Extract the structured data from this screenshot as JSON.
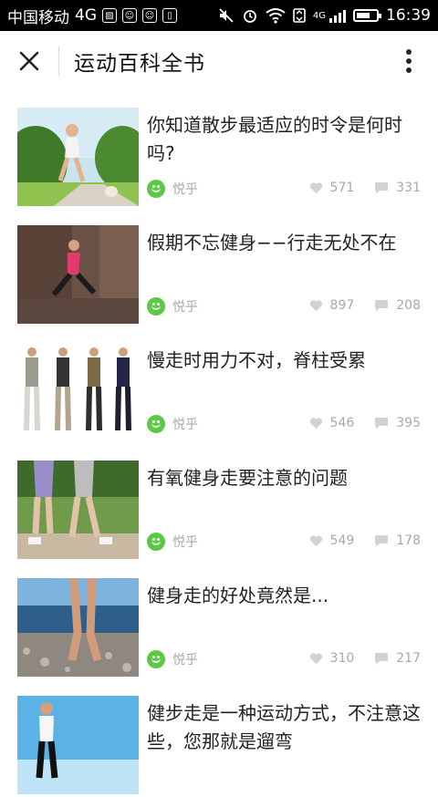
{
  "status_bar": {
    "carrier": "中国移动",
    "network": "4G",
    "signal_net": "4G",
    "time": "16:39",
    "icons": [
      "image-icon",
      "notification-icon",
      "notification-icon",
      "sim-icon",
      "mute-icon",
      "alarm-icon",
      "wifi-icon",
      "data-icon",
      "signal-icon",
      "battery-icon"
    ]
  },
  "header": {
    "title": "运动百科全书",
    "close_icon": "close-icon",
    "more_icon": "more-vertical-icon"
  },
  "colors": {
    "source_icon": "#5cc945",
    "meta_text": "#a8a8a8"
  },
  "articles": [
    {
      "title": "你知道散步最适应的时令是何时吗?",
      "source": "悦乎",
      "likes": "571",
      "comments": "331",
      "thumb": "woman-running-with-dog"
    },
    {
      "title": "假期不忘健身−−行走无处不在",
      "source": "悦乎",
      "likes": "897",
      "comments": "208",
      "thumb": "woman-running-on-path"
    },
    {
      "title": "慢走时用力不对，脊柱受累",
      "source": "悦乎",
      "likes": "546",
      "comments": "395",
      "thumb": "four-men-walking"
    },
    {
      "title": "有氧健身走要注意的问题",
      "source": "悦乎",
      "likes": "549",
      "comments": "178",
      "thumb": "legs-walking"
    },
    {
      "title": "健身走的好处竟然是...",
      "source": "悦乎",
      "likes": "310",
      "comments": "217",
      "thumb": "feet-on-pebbles"
    },
    {
      "title": "健步走是一种运动方式，不注意这些，您那就是遛弯",
      "source": "悦乎",
      "likes": "",
      "comments": "",
      "thumb": "woman-walking-sky"
    }
  ]
}
